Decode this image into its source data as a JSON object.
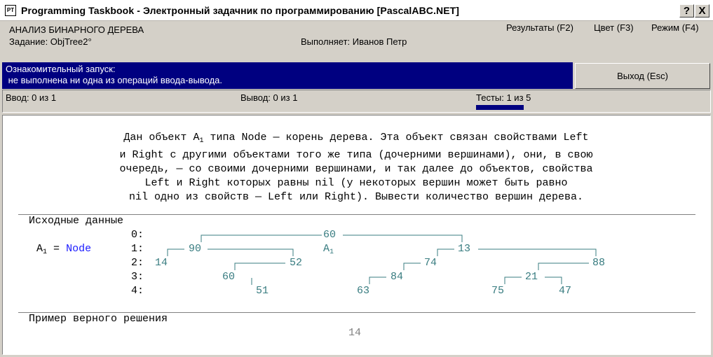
{
  "window": {
    "title": "Programming Taskbook - Электронный задачник по программированию [PascalABC.NET]",
    "help_button": "?",
    "close_button": "X"
  },
  "header": {
    "section": "АНАЛИЗ БИНАРНОГО ДЕРЕВА",
    "task": "Задание: ObjTree2°",
    "performer": "Выполняет: Иванов Петр",
    "menu": {
      "results": "Результаты (F2)",
      "color": "Цвет (F3)",
      "mode": "Режим (F4)"
    }
  },
  "status": {
    "line1": "Ознакомительный запуск:",
    "line2": " не выполнена ни одна из операций ввода-вывода."
  },
  "exit_button": "Выход (Esc)",
  "counters": {
    "input": "Ввод: 0 из 1",
    "output": "Вывод: 0 из 1",
    "tests": "Тесты: 1 из 5",
    "tests_progress": 0.2
  },
  "statement": {
    "line1_pre": "Дан объект A",
    "line1_sub": "1",
    "line1_post": " типа Node — корень дерева. Эта объект связан свойствами Left",
    "line2": "и Right с другими объектами того же типа (дочерними вершинами), они, в свою",
    "line3": "очередь, — со своими дочерними вершинами, и так далее до объектов, свойства",
    "line4": "Left и Right которых равны nil (у некоторых вершин может быть равно",
    "line5": "nil одно из свойств — Left или Right). Вывести количество вершин дерева."
  },
  "input_section": {
    "heading": "Исходные данные",
    "var_name": "A",
    "var_sub": "1",
    "equals": "=",
    "var_type": "Node",
    "levels": [
      "0:",
      "1:",
      "2:",
      "3:",
      "4:"
    ],
    "pointer_label": "A",
    "pointer_sub": "1",
    "nodes": [
      "60",
      "90",
      "13",
      "14",
      "52",
      "74",
      "88",
      "60",
      "84",
      "21",
      "51",
      "63",
      "75",
      "47"
    ]
  },
  "output_section": {
    "heading": "Пример верного решения",
    "answer": "14"
  }
}
